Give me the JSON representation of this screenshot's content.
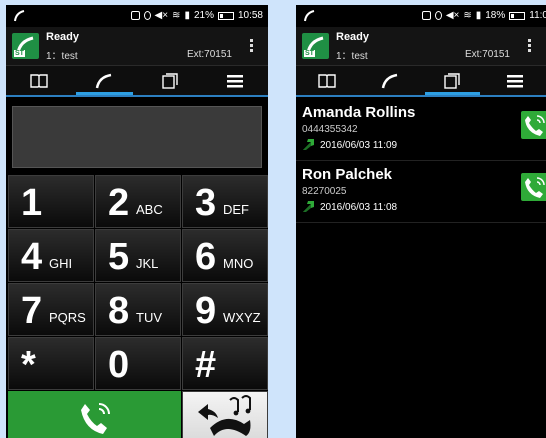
{
  "status": {
    "battery_left": "21%",
    "time_left": "10:58",
    "battery_right": "18%",
    "time_right": "11:0"
  },
  "account": {
    "status": "Ready",
    "line": "1：test",
    "ext": "Ext:70151",
    "icon_tag": "ST"
  },
  "tabs": [
    {
      "name": "contacts-book-icon"
    },
    {
      "name": "dialpad-handset-icon"
    },
    {
      "name": "recent-calls-icon"
    },
    {
      "name": "menu-icon"
    }
  ],
  "dialpad": {
    "keys": [
      {
        "digit": "1",
        "letters": ""
      },
      {
        "digit": "2",
        "letters": "ABC"
      },
      {
        "digit": "3",
        "letters": "DEF"
      },
      {
        "digit": "4",
        "letters": "GHI"
      },
      {
        "digit": "5",
        "letters": "JKL"
      },
      {
        "digit": "6",
        "letters": "MNO"
      },
      {
        "digit": "7",
        "letters": "PQRS"
      },
      {
        "digit": "8",
        "letters": "TUV"
      },
      {
        "digit": "9",
        "letters": "WXYZ"
      },
      {
        "digit": "*",
        "letters": ""
      },
      {
        "digit": "0",
        "letters": ""
      },
      {
        "digit": "#",
        "letters": ""
      }
    ]
  },
  "recents": [
    {
      "name": "Amanda Rollins",
      "number": "0444355342",
      "time": "2016/06/03 11:09"
    },
    {
      "name": "Ron Palchek",
      "number": "82270025",
      "time": "2016/06/03 11:08"
    }
  ],
  "colors": {
    "accent": "#2d9fe3",
    "call_green": "#2a9a35",
    "background": "#cfe4fb"
  }
}
